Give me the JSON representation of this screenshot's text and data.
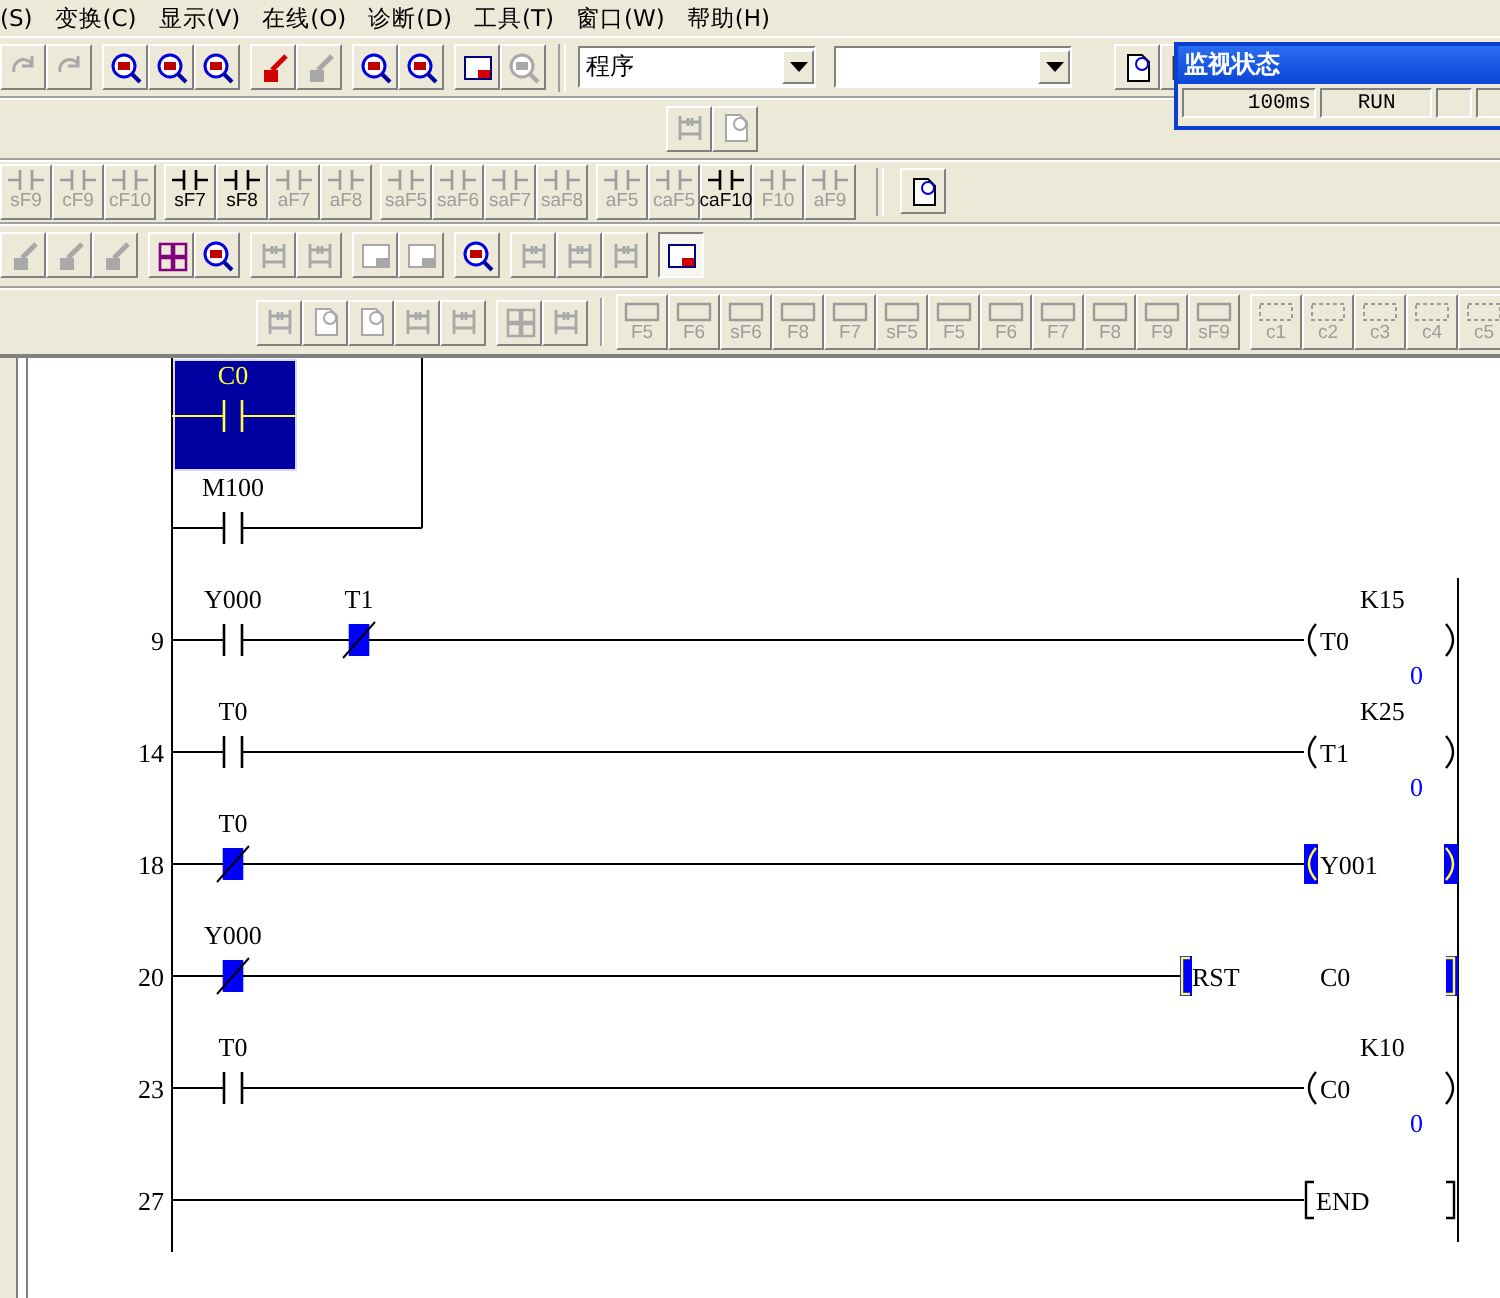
{
  "menu": [
    "(S)",
    "变换(C)",
    "显示(V)",
    "在线(O)",
    "诊断(D)",
    "工具(T)",
    "窗口(W)",
    "帮助(H)"
  ],
  "toolbar": {
    "buttons_left": [
      {
        "disabled": true
      },
      {
        "disabled": true
      },
      {
        "disabled": false
      },
      {
        "disabled": false
      },
      {
        "disabled": false
      },
      {
        "disabled": false
      },
      {
        "disabled": true
      },
      {
        "disabled": false
      },
      {
        "disabled": false
      },
      {
        "disabled": false
      },
      {
        "disabled": true
      }
    ],
    "program_select": {
      "value": "程序"
    },
    "buttons_right": [
      {
        "disabled": false
      },
      {
        "disabled": false
      }
    ]
  },
  "toolbar_2": {
    "buttons": [
      {
        "disabled": true
      },
      {
        "disabled": true
      }
    ]
  },
  "function_keys": {
    "groups": [
      [
        {
          "label": "sF9",
          "disabled": true
        },
        {
          "label": "cF9",
          "disabled": true
        },
        {
          "label": "cF10",
          "disabled": true
        }
      ],
      [
        {
          "label": "sF7",
          "disabled": false
        },
        {
          "label": "sF8",
          "disabled": false
        },
        {
          "label": "aF7",
          "disabled": true
        },
        {
          "label": "aF8",
          "disabled": true
        }
      ],
      [
        {
          "label": "saF5",
          "disabled": true
        },
        {
          "label": "saF6",
          "disabled": true
        },
        {
          "label": "saF7",
          "disabled": true
        },
        {
          "label": "saF8",
          "disabled": true
        }
      ],
      [
        {
          "label": "aF5",
          "disabled": true
        },
        {
          "label": "caF5",
          "disabled": true
        },
        {
          "label": "caF10",
          "disabled": false
        },
        {
          "label": "F10",
          "disabled": true
        },
        {
          "label": "aF9",
          "disabled": true
        }
      ]
    ],
    "buttons": [
      {
        "disabled": false
      }
    ]
  },
  "toolbar_4": {
    "buttons": [
      {
        "disabled": true,
        "pressed": false
      },
      {
        "disabled": true,
        "pressed": false
      },
      {
        "disabled": true,
        "pressed": false
      },
      {
        "disabled": false,
        "pressed": false
      },
      {
        "disabled": false,
        "pressed": false
      },
      {
        "disabled": true,
        "pressed": false
      },
      {
        "disabled": true,
        "pressed": false
      },
      {
        "disabled": true,
        "pressed": false
      },
      {
        "disabled": true,
        "pressed": false
      },
      {
        "disabled": false,
        "pressed": false
      },
      {
        "disabled": true,
        "pressed": false
      },
      {
        "disabled": true,
        "pressed": false
      },
      {
        "disabled": true,
        "pressed": false
      },
      {
        "disabled": false,
        "pressed": true
      }
    ]
  },
  "toolbar_5": {
    "buttons": [
      {
        "disabled": true
      },
      {
        "disabled": true
      },
      {
        "disabled": true
      },
      {
        "disabled": true
      },
      {
        "disabled": true
      },
      {
        "disabled": true
      },
      {
        "disabled": true
      }
    ],
    "keys": [
      {
        "label": "F5",
        "disabled": true
      },
      {
        "label": "F6",
        "disabled": true
      },
      {
        "label": "sF6",
        "disabled": true
      },
      {
        "label": "F8",
        "disabled": true
      },
      {
        "label": "F7",
        "disabled": true
      },
      {
        "label": "sF5",
        "disabled": true
      },
      {
        "label": "F5",
        "disabled": true
      },
      {
        "label": "F6",
        "disabled": true
      },
      {
        "label": "F7",
        "disabled": true
      },
      {
        "label": "F8",
        "disabled": true
      },
      {
        "label": "F9",
        "disabled": true
      },
      {
        "label": "sF9",
        "disabled": true
      }
    ],
    "comment_keys": [
      {
        "label": "c1",
        "disabled": true
      },
      {
        "label": "c2",
        "disabled": true
      },
      {
        "label": "c3",
        "disabled": true
      },
      {
        "label": "c4",
        "disabled": true
      },
      {
        "label": "c5",
        "disabled": true
      }
    ]
  },
  "ladder": {
    "rungs": [
      {
        "kind": "partial",
        "contacts": [
          {
            "label": "C0",
            "negated": false,
            "on": false,
            "selected": true
          }
        ]
      },
      {
        "kind": "branch",
        "contacts": [
          {
            "label": "M100",
            "negated": false,
            "on": false,
            "selected": false
          }
        ]
      },
      {
        "kind": "rung",
        "step": "9",
        "contacts": [
          {
            "label": "Y000",
            "negated": false,
            "on": false,
            "selected": false
          },
          {
            "label": "T1",
            "negated": true,
            "on": true,
            "selected": false
          }
        ],
        "output": {
          "kind": "coil",
          "device": "T0",
          "setting": "K15",
          "value": "0",
          "on": false
        }
      },
      {
        "kind": "rung",
        "step": "14",
        "contacts": [
          {
            "label": "T0",
            "negated": false,
            "on": false,
            "selected": false
          }
        ],
        "output": {
          "kind": "coil",
          "device": "T1",
          "setting": "K25",
          "value": "0",
          "on": false
        }
      },
      {
        "kind": "rung",
        "step": "18",
        "contacts": [
          {
            "label": "T0",
            "negated": true,
            "on": true,
            "selected": false
          }
        ],
        "output": {
          "kind": "coil",
          "device": "Y001",
          "on": true
        }
      },
      {
        "kind": "rung",
        "step": "20",
        "contacts": [
          {
            "label": "Y000",
            "negated": true,
            "on": true,
            "selected": false
          }
        ],
        "output": {
          "kind": "instruction",
          "op": "RST",
          "device": "C0",
          "on": true
        }
      },
      {
        "kind": "rung",
        "step": "23",
        "contacts": [
          {
            "label": "T0",
            "negated": false,
            "on": false,
            "selected": false
          }
        ],
        "output": {
          "kind": "coil",
          "device": "C0",
          "setting": "K10",
          "value": "0",
          "on": false
        }
      },
      {
        "kind": "rung",
        "step": "27",
        "output": {
          "kind": "instruction",
          "op": "END",
          "on": false
        }
      }
    ]
  },
  "monitor_window": {
    "title": "监视状态",
    "scan_time": "100ms",
    "status": "RUN"
  }
}
